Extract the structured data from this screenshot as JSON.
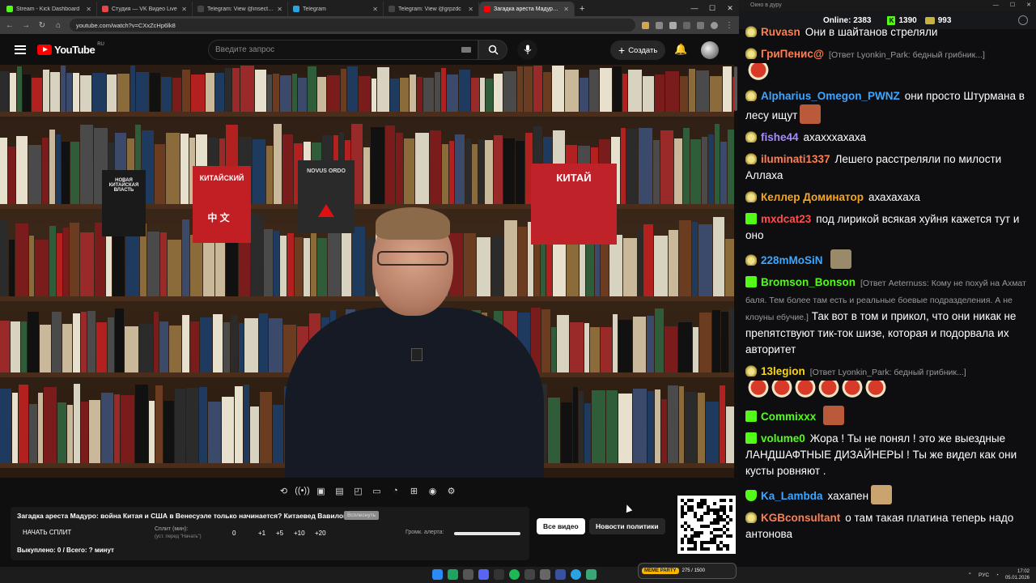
{
  "browser": {
    "tabs": [
      {
        "label": "Stream - Kick Dashboard",
        "color": "#53fc18",
        "active": false
      },
      {
        "label": "Студия — VK Видео Live",
        "color": "#e64646",
        "active": false
      },
      {
        "label": "Telegram: View @insect_life",
        "color": "#444444",
        "active": false
      },
      {
        "label": "Telegram",
        "color": "#2aa3e0",
        "active": false
      },
      {
        "label": "Telegram: View @grpzdc",
        "color": "#444444",
        "active": false
      },
      {
        "label": "Загадка ареста Мадуро: войн",
        "color": "#ff0000",
        "active": true
      }
    ],
    "url": "youtube.com/watch?v=CXxZcHp6lk8",
    "new_tab": "+"
  },
  "youtube": {
    "logo": "YouTube",
    "region": "RU",
    "search_placeholder": "Введите запрос",
    "create_label": "Создать"
  },
  "video": {
    "book_titles": [
      "НОВАЯ КИТАЙСКАЯ ВЛАСТЬ",
      "КИТАЙСКИЙ",
      "中 文",
      "NOVUS ORDO",
      "КИТАЙ"
    ]
  },
  "tools": {
    "icons": [
      "loop-icon",
      "broadcast-icon",
      "screenshot-icon",
      "frames-icon",
      "pip-icon",
      "theater-icon",
      "speed-icon",
      "add-frame-icon",
      "camera-icon",
      "settings-icon"
    ],
    "glyphs": [
      "⟲",
      "((•))",
      "▣",
      "▤",
      "◰",
      "▭",
      "◔",
      "⊞",
      "◉",
      "⚙"
    ]
  },
  "panel": {
    "title": "Загадка ареста Мадуро: война Китая и США в Венесуэле только начинается? Китаевед Вавилов",
    "badge": "Всплеснуть",
    "start_split": "НАЧАТЬ СПЛИТ",
    "split_label": "Сплит (мин):",
    "split_sub": "(уст. перед \"Начать\")",
    "split_value": "0",
    "increments": [
      "+1",
      "+5",
      "+10",
      "+20"
    ],
    "alert_label": "Громк. алерта:",
    "status": "Выкуплено: 0 / Всего: ? минут"
  },
  "pills": {
    "all_videos": "Все видео",
    "policy_news": "Новости политики"
  },
  "chat_window": {
    "title": "Окно в дуру",
    "online_label": "Online:",
    "online_count": "2383",
    "kick_count": "1390",
    "ticket_count": "993"
  },
  "chat": [
    {
      "badge": "sub",
      "user": "Ruvasn",
      "color": "#ff7f50",
      "text": "Они в шайтанов стреляли"
    },
    {
      "badge": "sub",
      "user": "ГриПенис@",
      "color": "#ff7f50",
      "reply": "[Ответ Lyonkin_Park: бедный грибник...]",
      "text": ""
    },
    {
      "badge": "sub",
      "user": "Alpharius_Omegon_PWNZ",
      "color": "#3ea6ff",
      "text": "они просто Штурмана в лесу ищут"
    },
    {
      "badge": "sub",
      "user": "fishe44",
      "color": "#a88bff",
      "text": "ахахххахаха"
    },
    {
      "badge": "sub",
      "user": "iluminati1337",
      "color": "#ff7f50",
      "text": "Лешего расстреляли по милости Аллаха"
    },
    {
      "badge": "sub",
      "user": "Келлер Доминатор",
      "color": "#f5a623",
      "text": "ахахахаха"
    },
    {
      "badge": "kick",
      "user": "mxdcat23",
      "color": "#ff4d4d",
      "text": "под лирикой всякая хуйня кажется тут и оно"
    },
    {
      "badge": "sub",
      "user": "228mMoSiN",
      "color": "#3ea6ff",
      "text": ""
    },
    {
      "badge": "kick",
      "user": "Bromson_Bonson",
      "color": "#53fc18",
      "reply": "[Ответ Aeternuss: Кому не похуй на Ахмат баля. Тем более там есть и реальные боевые подразделения. А не клоуны ебучие.]",
      "text": "Так вот в том и прикол, что они никак не препятствуют тик-ток шизе, которая и подорвала их авторитет"
    },
    {
      "badge": "sub",
      "user": "13legion",
      "color": "#f5d423",
      "reply": "[Ответ Lyonkin_Park: бедный грибник...]",
      "text": ""
    },
    {
      "badge": "kick",
      "user": "Commixxx",
      "color": "#53fc18",
      "text": ""
    },
    {
      "badge": "kick",
      "user": "volume0",
      "color": "#53fc18",
      "text": "Жора ! Ты не понял ! это же выездные ЛАНДШАФТНЫЕ ДИЗАЙНЕРЫ ! Ты же видел как они кусты ровняют ."
    },
    {
      "badge": "shield",
      "user": "Ka_Lambda",
      "color": "#3ea6ff",
      "text": "хахапен"
    },
    {
      "badge": "sub",
      "user": "KGBconsultant",
      "color": "#ff7f50",
      "text": "о там такая платина теперь надо антонова"
    }
  ],
  "taskbar": {
    "meme_title": "MEME PARTY",
    "meme_counter": "275 / 1500",
    "lang": "РУС",
    "time": "17:02",
    "date": "05.01.2026"
  }
}
